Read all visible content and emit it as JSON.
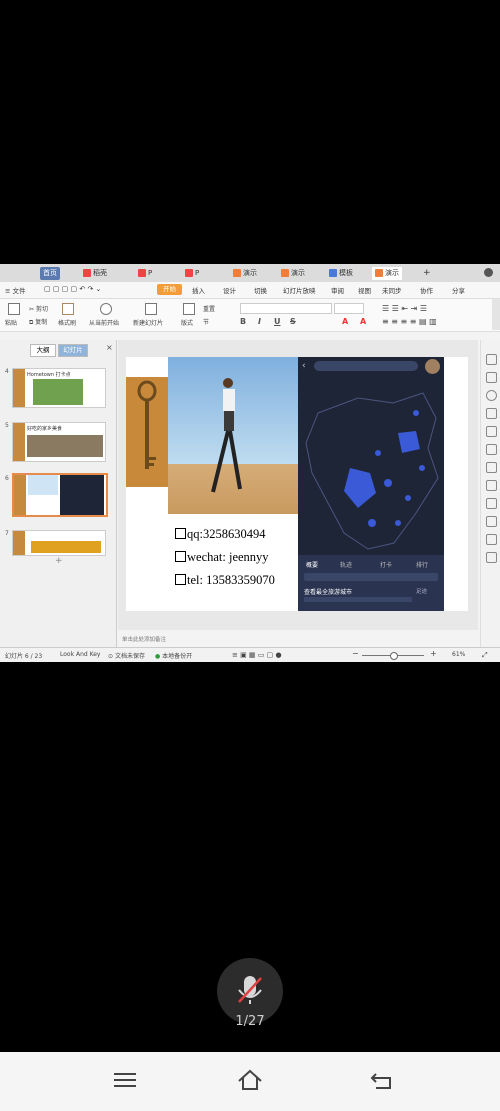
{
  "tabs": [
    {
      "label": "首页"
    },
    {
      "label": "稻壳"
    },
    {
      "label": "P"
    },
    {
      "label": "P"
    },
    {
      "label": "演示"
    },
    {
      "label": "演示"
    },
    {
      "label": "模板"
    },
    {
      "label": "演示"
    }
  ],
  "menu": {
    "file": "文件",
    "items": [
      "开始",
      "插入",
      "设计",
      "切换",
      "幻灯片放映",
      "审阅",
      "视图"
    ],
    "right": [
      "未同步",
      "协作",
      "分享"
    ]
  },
  "ribbon": {
    "paste": "粘贴",
    "cut": "剪切",
    "copy": "复制",
    "format_painter": "格式刷",
    "play": "从当前开始",
    "new_slide": "新建幻灯片",
    "layout": "版式",
    "reset": "重置",
    "section": "节"
  },
  "left_panel": {
    "tab_outline": "大纲",
    "tab_slides": "幻灯片",
    "slides": [
      {
        "num": "4",
        "title": "Hometown 打卡点"
      },
      {
        "num": "5",
        "title": "好吃的家乡美食"
      },
      {
        "num": "6",
        "title": ""
      },
      {
        "num": "7",
        "title": ""
      }
    ]
  },
  "slide": {
    "contacts": [
      "qq:3258630494",
      "wechat: jeennyy",
      "tel: 13583359070"
    ],
    "phone_tabs": [
      "概要",
      "轨迹",
      "打卡",
      "排行"
    ],
    "phone_bottom": "查看最全旅游城市",
    "phone_link": "足迹"
  },
  "status": {
    "slide_count": "幻灯片 6 / 23",
    "theme": "Look And Key",
    "backup": "文档未保存",
    "local": "本地备份开",
    "notes": "单击此处添加备注",
    "zoom": "61%"
  },
  "overlay": {
    "counter": "1/27"
  },
  "colors": {
    "accent_orange": "#f19d3a",
    "phone_bg": "#1e2537",
    "map_blue": "#3a5ad8"
  }
}
